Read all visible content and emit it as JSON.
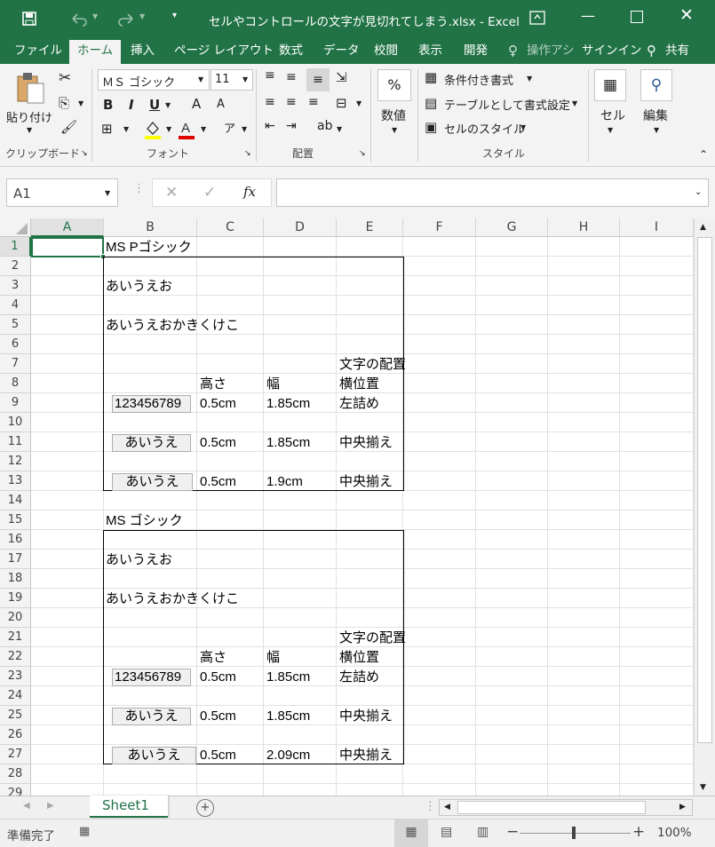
{
  "titlebar": {
    "title": "セルやコントロールの文字が見切れてしまう.xlsx - Excel",
    "save_icon": "save-icon",
    "undo_icon": "undo-icon",
    "redo_icon": "redo-icon"
  },
  "tabs": [
    "ファイル",
    "ホーム",
    "挿入",
    "ページ レイアウト",
    "数式",
    "データ",
    "校閲",
    "表示",
    "開発",
    "操作アシ",
    "サインイン",
    "共有"
  ],
  "ribbon": {
    "paste": "貼り付け",
    "clipboard": "クリップボード",
    "font_name": "ＭＳ ゴシック",
    "font_size": "11",
    "bold": "B",
    "italic": "I",
    "underline": "U",
    "grow": "A",
    "shrink": "A",
    "font_group": "フォント",
    "alignment_group": "配置",
    "number": "数値",
    "percent": "%",
    "cond_format": "条件付き書式",
    "table_format": "テーブルとして書式設定",
    "cell_style": "セルのスタイル",
    "style_group": "スタイル",
    "cells": "セル",
    "edit": "編集"
  },
  "formula_bar": {
    "name_box": "A1",
    "fx": "fx",
    "value": ""
  },
  "columns": [
    "A",
    "B",
    "C",
    "D",
    "E",
    "F",
    "G",
    "H",
    "I"
  ],
  "rows": [
    "1",
    "2",
    "3",
    "4",
    "5",
    "6",
    "7",
    "8",
    "9",
    "10",
    "11",
    "12",
    "13",
    "14",
    "15",
    "16",
    "17",
    "18",
    "19",
    "20",
    "21",
    "22",
    "23",
    "24",
    "25",
    "26",
    "27",
    "28",
    "29"
  ],
  "cells": {
    "b1": "MS Pゴシック",
    "b3": "あいうえお",
    "b5": "あいうえおかきくけこ",
    "e7": "文字の配置",
    "c8": "高さ",
    "d8": "幅",
    "e8": "横位置",
    "btn9": "123456789",
    "c9": "0.5cm",
    "d9": "1.85cm",
    "e9": "左詰め",
    "btn11": "あいうえ",
    "c11": "0.5cm",
    "d11": "1.85cm",
    "e11": "中央揃え",
    "btn13": "あいうえ",
    "c13": "0.5cm",
    "d13": "1.9cm",
    "e13": "中央揃え",
    "b15": "MS ゴシック",
    "b17": "あいうえお",
    "b19": "あいうえおかきくけこ",
    "e21": "文字の配置",
    "c22": "高さ",
    "d22": "幅",
    "e22": "横位置",
    "btn23": "123456789",
    "c23": "0.5cm",
    "d23": "1.85cm",
    "e23": "左詰め",
    "btn25": "あいうえ",
    "c25": "0.5cm",
    "d25": "1.85cm",
    "e25": "中央揃え",
    "btn27": "あいうえ",
    "c27": "0.5cm",
    "d27": "2.09cm",
    "e27": "中央揃え"
  },
  "sheet_tab": "Sheet1",
  "status": {
    "ready": "準備完了",
    "zoom": "100%"
  },
  "colors": {
    "accent": "#217346",
    "selection": "#217346"
  }
}
